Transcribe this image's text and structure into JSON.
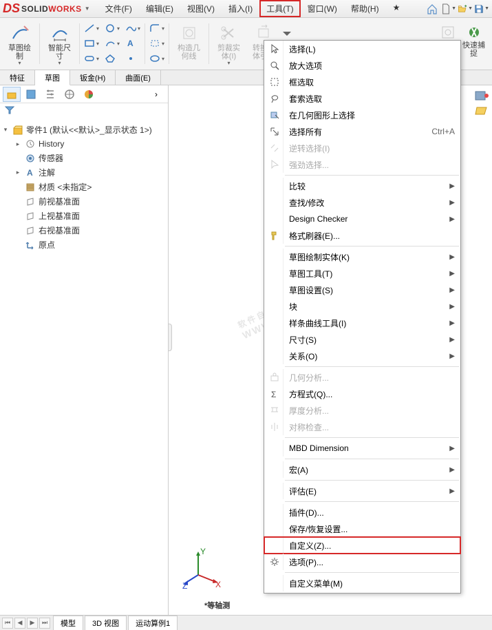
{
  "app": {
    "brand_solid": "SOLID",
    "brand_works": "WORKS"
  },
  "menubar": [
    {
      "label": "文件(F)"
    },
    {
      "label": "编辑(E)"
    },
    {
      "label": "视图(V)"
    },
    {
      "label": "插入(I)"
    },
    {
      "label": "工具(T)",
      "highlighted": true
    },
    {
      "label": "窗口(W)"
    },
    {
      "label": "帮助(H)"
    }
  ],
  "ribbon": {
    "sketch_draw": "草图绘\n制",
    "smart_dim": "智能尺\n寸",
    "construct_geom": "构造几\n何线",
    "trim_solid": "剪裁实\n体(I)",
    "convert_ref": "转换实\n体引用",
    "quick_snap": "快速捕\n捉"
  },
  "tabs": [
    {
      "label": "特征"
    },
    {
      "label": "草图",
      "active": true
    },
    {
      "label": "钣金(H)"
    },
    {
      "label": "曲面(E)"
    }
  ],
  "tree": {
    "root": "零件1 (默认<<默认>_显示状态 1>)",
    "history": "History",
    "sensors": "传感器",
    "annotations": "注解",
    "material": "材质 <未指定>",
    "front_plane": "前视基准面",
    "top_plane": "上视基准面",
    "right_plane": "右视基准面",
    "origin": "原点"
  },
  "view_label": "*等轴测",
  "context_menu": {
    "select": "选择(L)",
    "zoom_options": "放大选项",
    "box_select": "框选取",
    "lasso_select": "套索选取",
    "select_on_geom": "在几何图形上选择",
    "select_all": "选择所有",
    "select_all_shortcut": "Ctrl+A",
    "invert_select": "逆转选择(I)",
    "power_select": "强劲选择...",
    "compare": "比较",
    "find_replace": "查找/修改",
    "design_checker": "Design Checker",
    "format_painter": "格式刷器(E)...",
    "sketch_entities": "草图绘制实体(K)",
    "sketch_tools": "草图工具(T)",
    "sketch_settings": "草图设置(S)",
    "block": "块",
    "spline_tools": "样条曲线工具(I)",
    "dimension": "尺寸(S)",
    "relation": "关系(O)",
    "geom_analysis": "几何分析...",
    "equations": "方程式(Q)...",
    "thickness_analysis": "厚度分析...",
    "symmetry_check": "对称检查...",
    "mbd_dimension": "MBD Dimension",
    "macro": "宏(A)",
    "evaluate": "评估(E)",
    "addins": "插件(D)...",
    "save_restore": "保存/恢复设置...",
    "customize": "自定义(Z)...",
    "options": "选项(P)...",
    "custom_menu": "自定义菜单(M)"
  },
  "bottom_tabs": [
    {
      "label": "模型"
    },
    {
      "label": "3D 视图"
    },
    {
      "label": "运动算例1"
    }
  ],
  "watermark": {
    "main": "软件自学网",
    "sub": "WWW.RJZXW.COM"
  }
}
